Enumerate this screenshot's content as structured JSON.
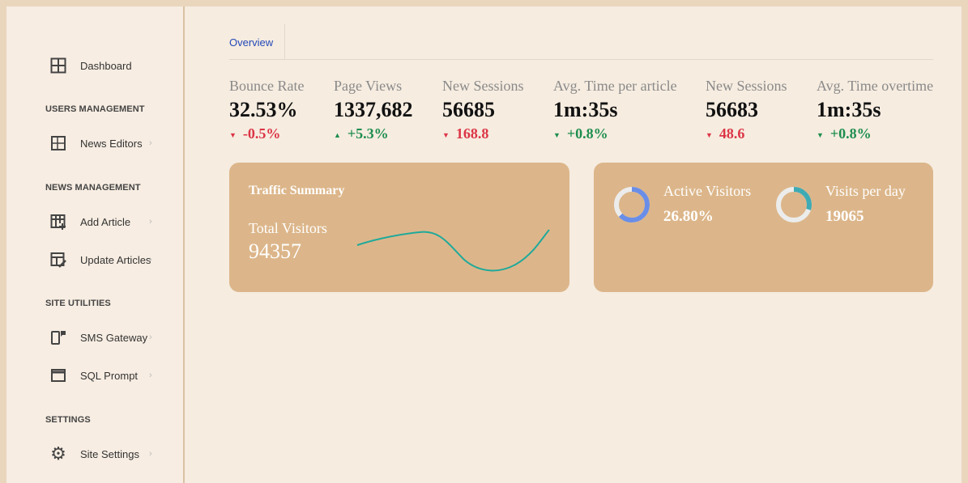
{
  "sidebar": {
    "dashboard": "Dashboard",
    "sections": [
      "USERS MANAGEMENT",
      "NEWS MANAGEMENT",
      "SITE UTILITIES",
      "SETTINGS"
    ],
    "items": [
      {
        "label": "News Editors",
        "icon": "users-table-icon"
      },
      {
        "label": "Add Article",
        "icon": "table-plus-icon"
      },
      {
        "label": "Update Articles",
        "icon": "table-edit-icon"
      },
      {
        "label": "SMS Gateway",
        "icon": "phone-message-icon"
      },
      {
        "label": "SQL Prompt",
        "icon": "window-icon"
      },
      {
        "label": "Site Settings",
        "icon": "gear-icon"
      }
    ]
  },
  "tabs": {
    "overview": "Overview"
  },
  "stats": [
    {
      "title": "Bounce Rate",
      "value": "32.53%",
      "change": "-0.5%",
      "direction": "down",
      "color": "#dc3545"
    },
    {
      "title": "Page Views",
      "value": "1337,682",
      "change": "+5.3%",
      "direction": "up",
      "color": "#1e8e4e"
    },
    {
      "title": "New Sessions",
      "value": "56685",
      "change": "168.8",
      "direction": "down",
      "color": "#dc3545"
    },
    {
      "title": "Avg. Time per article",
      "value": "1m:35s",
      "change": "+0.8%",
      "direction": "down",
      "color": "#1e8e4e"
    },
    {
      "title": "New Sessions",
      "value": "56683",
      "change": "48.6",
      "direction": "down",
      "color": "#dc3545"
    },
    {
      "title": "Avg. Time overtime",
      "value": "1m:35s",
      "change": "+0.8%",
      "direction": "down",
      "color": "#1e8e4e"
    }
  ],
  "traffic": {
    "title": "Traffic Summary",
    "label": "Total Visitors",
    "value": "94357",
    "line_color": "#20a99a"
  },
  "donuts": [
    {
      "label": "Active Visitors",
      "value": "26.80%",
      "fill": 0.63,
      "color": "#6a8ee8"
    },
    {
      "label": "Visits per day",
      "value": "19065",
      "fill": 0.3,
      "color": "#3eaab4"
    }
  ],
  "colors": {
    "card": "#dcb68a",
    "accent": "#2448b8"
  }
}
